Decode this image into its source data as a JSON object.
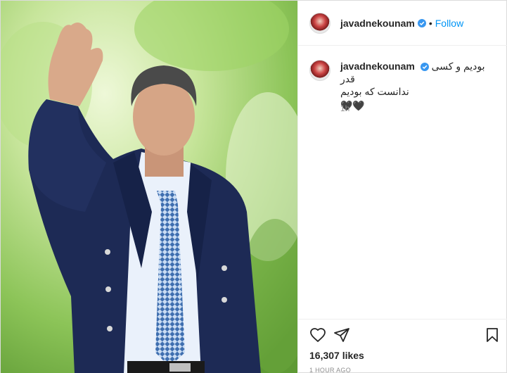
{
  "post": {
    "username": "javadnekounam",
    "separator": "•",
    "follow_label": "Follow",
    "caption_line1": "بودیم و کسی قدر",
    "caption_line2": "ندانست که بودیم",
    "caption_emoji": "🖤🖤",
    "relative_time": "1h",
    "likes": "16,307 likes",
    "time_ago": "1 HOUR AGO"
  },
  "icons": {
    "verified": "verified-badge-icon",
    "like": "heart-outline-icon",
    "share": "paper-plane-icon",
    "save": "bookmark-outline-icon"
  },
  "colors": {
    "accent": "#0095f6",
    "verified": "#3897f0",
    "secondary_text": "#8e8e8e"
  }
}
